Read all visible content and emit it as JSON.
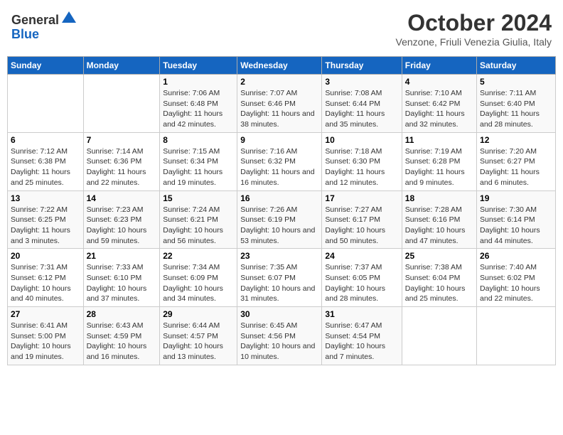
{
  "header": {
    "logo_line1": "General",
    "logo_line2": "Blue",
    "month_title": "October 2024",
    "location": "Venzone, Friuli Venezia Giulia, Italy"
  },
  "days_of_week": [
    "Sunday",
    "Monday",
    "Tuesday",
    "Wednesday",
    "Thursday",
    "Friday",
    "Saturday"
  ],
  "weeks": [
    [
      {
        "day": "",
        "info": ""
      },
      {
        "day": "",
        "info": ""
      },
      {
        "day": "1",
        "info": "Sunrise: 7:06 AM\nSunset: 6:48 PM\nDaylight: 11 hours and 42 minutes."
      },
      {
        "day": "2",
        "info": "Sunrise: 7:07 AM\nSunset: 6:46 PM\nDaylight: 11 hours and 38 minutes."
      },
      {
        "day": "3",
        "info": "Sunrise: 7:08 AM\nSunset: 6:44 PM\nDaylight: 11 hours and 35 minutes."
      },
      {
        "day": "4",
        "info": "Sunrise: 7:10 AM\nSunset: 6:42 PM\nDaylight: 11 hours and 32 minutes."
      },
      {
        "day": "5",
        "info": "Sunrise: 7:11 AM\nSunset: 6:40 PM\nDaylight: 11 hours and 28 minutes."
      }
    ],
    [
      {
        "day": "6",
        "info": "Sunrise: 7:12 AM\nSunset: 6:38 PM\nDaylight: 11 hours and 25 minutes."
      },
      {
        "day": "7",
        "info": "Sunrise: 7:14 AM\nSunset: 6:36 PM\nDaylight: 11 hours and 22 minutes."
      },
      {
        "day": "8",
        "info": "Sunrise: 7:15 AM\nSunset: 6:34 PM\nDaylight: 11 hours and 19 minutes."
      },
      {
        "day": "9",
        "info": "Sunrise: 7:16 AM\nSunset: 6:32 PM\nDaylight: 11 hours and 16 minutes."
      },
      {
        "day": "10",
        "info": "Sunrise: 7:18 AM\nSunset: 6:30 PM\nDaylight: 11 hours and 12 minutes."
      },
      {
        "day": "11",
        "info": "Sunrise: 7:19 AM\nSunset: 6:28 PM\nDaylight: 11 hours and 9 minutes."
      },
      {
        "day": "12",
        "info": "Sunrise: 7:20 AM\nSunset: 6:27 PM\nDaylight: 11 hours and 6 minutes."
      }
    ],
    [
      {
        "day": "13",
        "info": "Sunrise: 7:22 AM\nSunset: 6:25 PM\nDaylight: 11 hours and 3 minutes."
      },
      {
        "day": "14",
        "info": "Sunrise: 7:23 AM\nSunset: 6:23 PM\nDaylight: 10 hours and 59 minutes."
      },
      {
        "day": "15",
        "info": "Sunrise: 7:24 AM\nSunset: 6:21 PM\nDaylight: 10 hours and 56 minutes."
      },
      {
        "day": "16",
        "info": "Sunrise: 7:26 AM\nSunset: 6:19 PM\nDaylight: 10 hours and 53 minutes."
      },
      {
        "day": "17",
        "info": "Sunrise: 7:27 AM\nSunset: 6:17 PM\nDaylight: 10 hours and 50 minutes."
      },
      {
        "day": "18",
        "info": "Sunrise: 7:28 AM\nSunset: 6:16 PM\nDaylight: 10 hours and 47 minutes."
      },
      {
        "day": "19",
        "info": "Sunrise: 7:30 AM\nSunset: 6:14 PM\nDaylight: 10 hours and 44 minutes."
      }
    ],
    [
      {
        "day": "20",
        "info": "Sunrise: 7:31 AM\nSunset: 6:12 PM\nDaylight: 10 hours and 40 minutes."
      },
      {
        "day": "21",
        "info": "Sunrise: 7:33 AM\nSunset: 6:10 PM\nDaylight: 10 hours and 37 minutes."
      },
      {
        "day": "22",
        "info": "Sunrise: 7:34 AM\nSunset: 6:09 PM\nDaylight: 10 hours and 34 minutes."
      },
      {
        "day": "23",
        "info": "Sunrise: 7:35 AM\nSunset: 6:07 PM\nDaylight: 10 hours and 31 minutes."
      },
      {
        "day": "24",
        "info": "Sunrise: 7:37 AM\nSunset: 6:05 PM\nDaylight: 10 hours and 28 minutes."
      },
      {
        "day": "25",
        "info": "Sunrise: 7:38 AM\nSunset: 6:04 PM\nDaylight: 10 hours and 25 minutes."
      },
      {
        "day": "26",
        "info": "Sunrise: 7:40 AM\nSunset: 6:02 PM\nDaylight: 10 hours and 22 minutes."
      }
    ],
    [
      {
        "day": "27",
        "info": "Sunrise: 6:41 AM\nSunset: 5:00 PM\nDaylight: 10 hours and 19 minutes."
      },
      {
        "day": "28",
        "info": "Sunrise: 6:43 AM\nSunset: 4:59 PM\nDaylight: 10 hours and 16 minutes."
      },
      {
        "day": "29",
        "info": "Sunrise: 6:44 AM\nSunset: 4:57 PM\nDaylight: 10 hours and 13 minutes."
      },
      {
        "day": "30",
        "info": "Sunrise: 6:45 AM\nSunset: 4:56 PM\nDaylight: 10 hours and 10 minutes."
      },
      {
        "day": "31",
        "info": "Sunrise: 6:47 AM\nSunset: 4:54 PM\nDaylight: 10 hours and 7 minutes."
      },
      {
        "day": "",
        "info": ""
      },
      {
        "day": "",
        "info": ""
      }
    ]
  ]
}
